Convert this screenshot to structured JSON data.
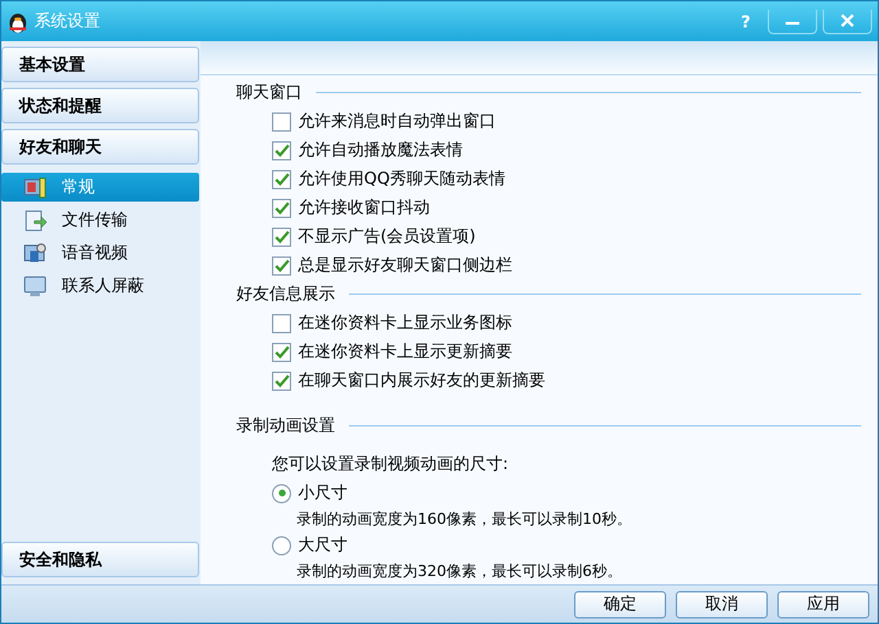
{
  "window": {
    "title": "系统设置",
    "help": "?"
  },
  "sidebar": {
    "categories": [
      {
        "label": "基本设置"
      },
      {
        "label": "状态和提醒"
      },
      {
        "label": "好友和聊天",
        "items": [
          {
            "label": "常规",
            "selected": true
          },
          {
            "label": "文件传输",
            "selected": false
          },
          {
            "label": "语音视频",
            "selected": false
          },
          {
            "label": "联系人屏蔽",
            "selected": false
          }
        ]
      }
    ],
    "bottom_category": {
      "label": "安全和隐私"
    }
  },
  "sections": [
    {
      "title": "聊天窗口",
      "kind": "checkboxes",
      "options": [
        {
          "label": "允许来消息时自动弹出窗口",
          "checked": false
        },
        {
          "label": "允许自动播放魔法表情",
          "checked": true
        },
        {
          "label": "允许使用QQ秀聊天随动表情",
          "checked": true
        },
        {
          "label": "允许接收窗口抖动",
          "checked": true
        },
        {
          "label": "不显示广告(会员设置项)",
          "checked": true
        },
        {
          "label": "总是显示好友聊天窗口侧边栏",
          "checked": true
        }
      ]
    },
    {
      "title": "好友信息展示",
      "kind": "checkboxes",
      "options": [
        {
          "label": "在迷你资料卡上显示业务图标",
          "checked": false
        },
        {
          "label": "在迷你资料卡上显示更新摘要",
          "checked": true
        },
        {
          "label": "在聊天窗口内展示好友的更新摘要",
          "checked": true
        }
      ]
    },
    {
      "title": "录制动画设置",
      "kind": "radios",
      "intro": "您可以设置录制视频动画的尺寸:",
      "options": [
        {
          "label": "小尺寸",
          "selected": true,
          "description": "录制的动画宽度为160像素，最长可以录制10秒。"
        },
        {
          "label": "大尺寸",
          "selected": false,
          "description": "录制的动画宽度为320像素，最长可以录制6秒。"
        }
      ]
    }
  ],
  "buttons": [
    "确定",
    "取消",
    "应用"
  ]
}
